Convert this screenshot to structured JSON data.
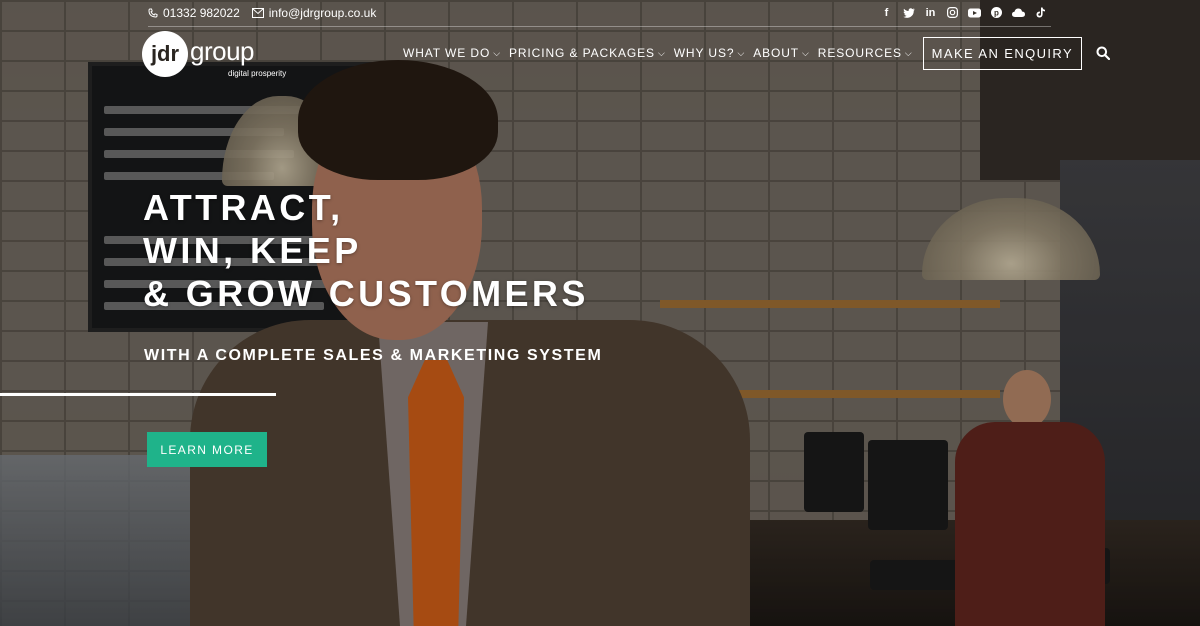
{
  "topbar": {
    "phone": "01332 982022",
    "email": "info@jdrgroup.co.uk",
    "socials": [
      "facebook-icon",
      "twitter-icon",
      "linkedin-icon",
      "instagram-icon",
      "youtube-icon",
      "pinterest-icon",
      "cloud-icon",
      "tiktok-icon"
    ]
  },
  "logo": {
    "mark": "jdr",
    "name": "group",
    "tagline": "digital prosperity"
  },
  "nav": {
    "items": [
      {
        "label": "WHAT WE DO"
      },
      {
        "label": "PRICING & PACKAGES"
      },
      {
        "label": "WHY US?"
      },
      {
        "label": "ABOUT"
      },
      {
        "label": "RESOURCES"
      }
    ],
    "cta": "MAKE AN ENQUIRY"
  },
  "hero": {
    "headline": [
      "ATTRACT,",
      "WIN, KEEP",
      "& GROW CUSTOMERS"
    ],
    "subheadline": "WITH A COMPLETE SALES & MARKETING SYSTEM",
    "button": "LEARN MORE",
    "slide_progress": 0.23,
    "accent": "#1fb38a"
  }
}
